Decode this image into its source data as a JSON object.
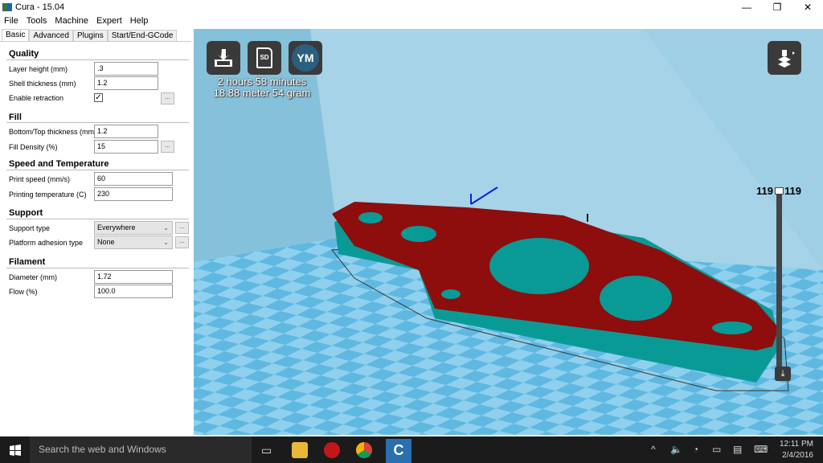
{
  "window": {
    "title": "Cura - 15.04",
    "min": "—",
    "max": "❐",
    "close": "✕"
  },
  "menu": [
    "File",
    "Tools",
    "Machine",
    "Expert",
    "Help"
  ],
  "tabs": [
    "Basic",
    "Advanced",
    "Plugins",
    "Start/End-GCode"
  ],
  "quality": {
    "heading": "Quality",
    "layer_height_label": "Layer height (mm)",
    "layer_height": ".3",
    "shell_label": "Shell thickness (mm)",
    "shell": "1.2",
    "retraction_label": "Enable retraction",
    "retraction_checked": "✓"
  },
  "fill": {
    "heading": "Fill",
    "bottom_top_label": "Bottom/Top thickness (mm)",
    "bottom_top": "1.2",
    "density_label": "Fill Density (%)",
    "density": "15"
  },
  "speed": {
    "heading": "Speed and Temperature",
    "print_speed_label": "Print speed (mm/s)",
    "print_speed": "60",
    "temp_label": "Printing temperature (C)",
    "temp": "230"
  },
  "support": {
    "heading": "Support",
    "type_label": "Support type",
    "type": "Everywhere",
    "adhesion_label": "Platform adhesion type",
    "adhesion": "None"
  },
  "filament": {
    "heading": "Filament",
    "diameter_label": "Diameter (mm)",
    "diameter": "1.72",
    "flow_label": "Flow (%)",
    "flow": "100.0"
  },
  "dots": "...",
  "viewport": {
    "sd_label": "SD",
    "ym_label": "YM",
    "print_time": "2 hours 58 minutes",
    "material": "18.88 meter 54 gram",
    "layer_min": "119",
    "layer_max": "119",
    "layer_fraction": 1.0
  },
  "taskbar": {
    "search_placeholder": "Search the web and Windows",
    "time": "12:11 PM",
    "date": "2/4/2016"
  }
}
